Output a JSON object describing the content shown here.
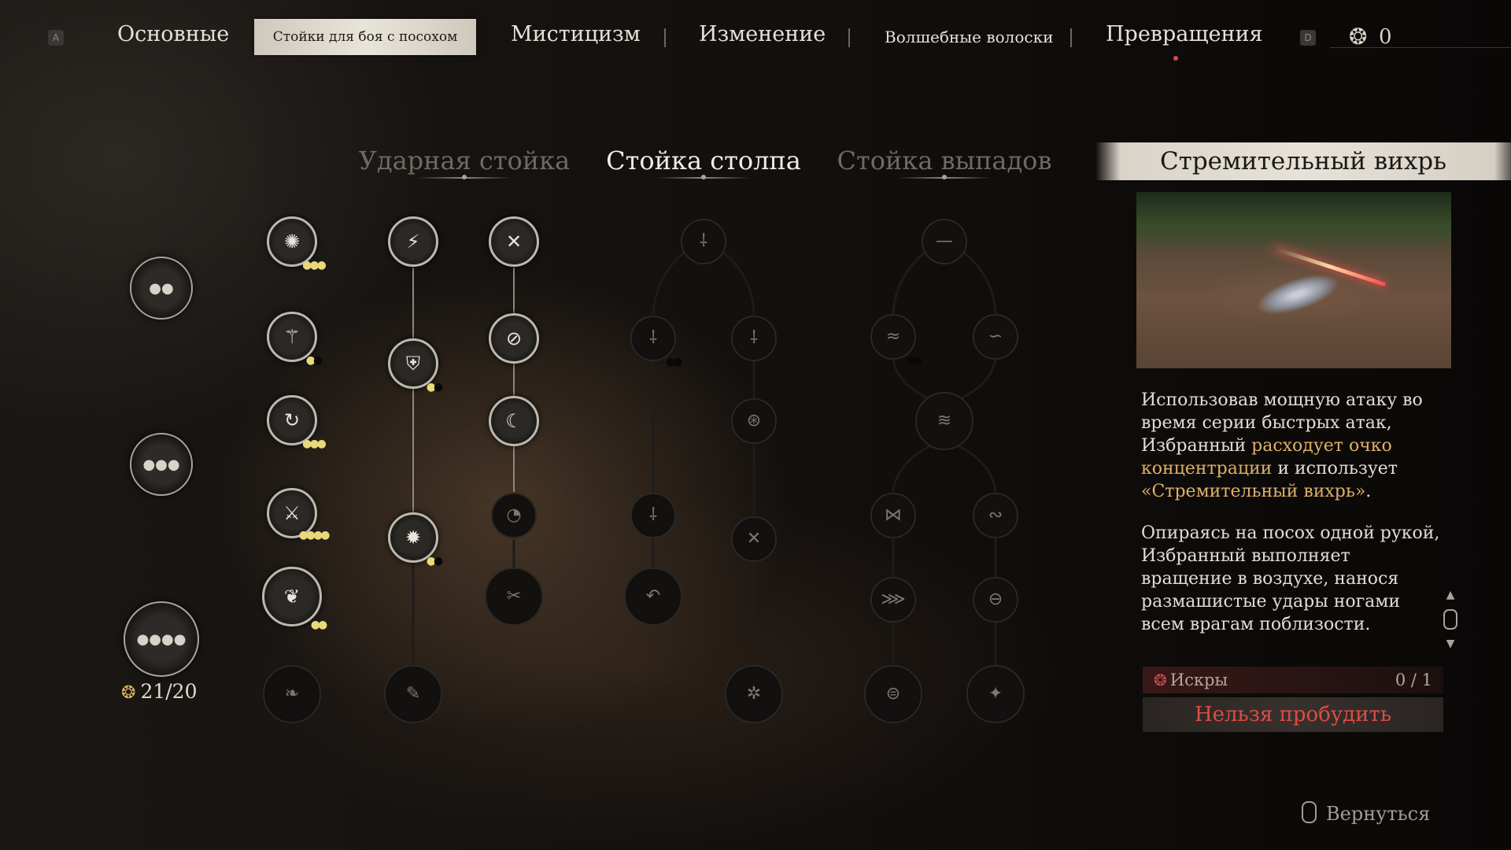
{
  "top_tabs": {
    "key_left": "A",
    "key_right": "D",
    "tabs": [
      {
        "label": "Основные"
      },
      {
        "label": "Стойки для боя с посохом"
      },
      {
        "label": "Мистицизм"
      },
      {
        "label": "Изменение"
      },
      {
        "label": "Волшебные волоски"
      },
      {
        "label": "Превращения"
      }
    ],
    "active_tab": "Стойки для боя с посохом",
    "currency_value": "0"
  },
  "stances": [
    {
      "label": "Ударная стойка",
      "active": false
    },
    {
      "label": "Стойка столпа",
      "active": true
    },
    {
      "label": "Стойка выпадов",
      "active": false
    }
  ],
  "sparks_total": "21/20",
  "panel": {
    "title": "Стремительный вихрь",
    "desc_p1_a": "Использовав мощную атаку во время серии быстрых атак, Избранный ",
    "desc_p1_hl1": "расходует очко концентрации",
    "desc_p1_b": " и использует ",
    "desc_p1_hl2": "«Стремительный вихрь»",
    "desc_p1_c": ".",
    "desc_p2": "Опираясь на посох одной рукой, Избранный выполняет вращение в воздухе, нанося размашистые удары ногами всем врагам поблизости.",
    "req_label": "Искры",
    "req_value": "0 / 1",
    "awaken_label": "Нельзя пробудить"
  },
  "footer": {
    "back_label": "Вернуться"
  },
  "colors": {
    "accent_gold": "#e0b067",
    "warning_red": "#de4c45"
  }
}
